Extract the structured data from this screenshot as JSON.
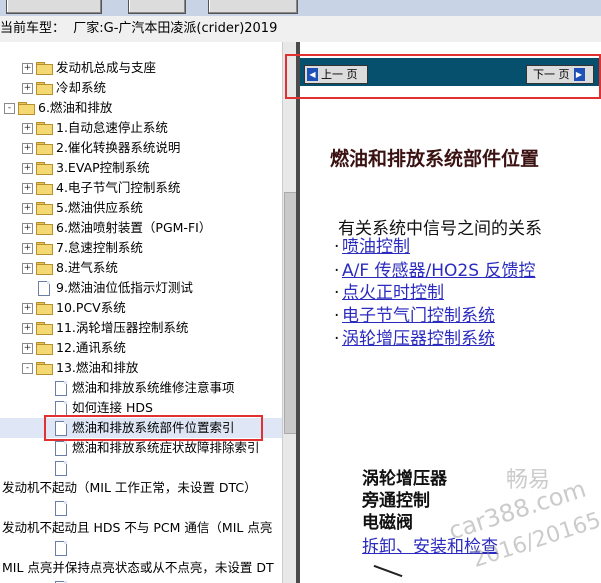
{
  "model": {
    "label": "当前车型：",
    "value": "厂家:G-广汽本田凌派(crider)2019"
  },
  "tree": [
    {
      "text": "发动机总成与支座",
      "type": "folder",
      "expander": "+",
      "indent": 1
    },
    {
      "text": "冷却系统",
      "type": "folder",
      "expander": "+",
      "indent": 1
    },
    {
      "text": "6.燃油和排放",
      "type": "folder",
      "expander": "-",
      "indent": 0
    },
    {
      "text": "1.自动怠速停止系统",
      "type": "folder",
      "expander": "+",
      "indent": 1
    },
    {
      "text": "2.催化转换器系统说明",
      "type": "folder",
      "expander": "+",
      "indent": 1
    },
    {
      "text": "3.EVAP控制系统",
      "type": "folder",
      "expander": "+",
      "indent": 1
    },
    {
      "text": "4.电子节气门控制系统",
      "type": "folder",
      "expander": "+",
      "indent": 1
    },
    {
      "text": "5.燃油供应系统",
      "type": "folder",
      "expander": "+",
      "indent": 1
    },
    {
      "text": "6.燃油喷射装置（PGM-FI）",
      "type": "folder",
      "expander": "+",
      "indent": 1
    },
    {
      "text": "7.怠速控制系统",
      "type": "folder",
      "expander": "+",
      "indent": 1
    },
    {
      "text": "8.进气系统",
      "type": "folder",
      "expander": "+",
      "indent": 1
    },
    {
      "text": "9.燃油油位低指示灯测试",
      "type": "doc",
      "expander": "",
      "indent": 1
    },
    {
      "text": "10.PCV系统",
      "type": "folder",
      "expander": "+",
      "indent": 1
    },
    {
      "text": "11.涡轮增压器控制系统",
      "type": "folder",
      "expander": "+",
      "indent": 1
    },
    {
      "text": "12.通讯系统",
      "type": "folder",
      "expander": "+",
      "indent": 1
    },
    {
      "text": "13.燃油和排放",
      "type": "folder",
      "expander": "-",
      "indent": 1
    },
    {
      "text": "燃油和排放系统维修注意事项",
      "type": "doc",
      "expander": "",
      "indent": 2
    },
    {
      "text": "如何连接 HDS",
      "type": "doc",
      "expander": "",
      "indent": 2
    },
    {
      "text": "燃油和排放系统部件位置索引",
      "type": "doc",
      "expander": "",
      "indent": 2,
      "selected": true
    },
    {
      "text": "燃油和排放系统症状故障排除索引",
      "type": "doc",
      "expander": "",
      "indent": 2
    },
    {
      "text": "",
      "type": "doc",
      "expander": "",
      "indent": 2
    },
    {
      "text": "发动机不起动（MIL 工作正常，未设置 DTC）",
      "type": "text",
      "expander": "",
      "indent": -1
    },
    {
      "text": "",
      "type": "doc",
      "expander": "",
      "indent": 2
    },
    {
      "text": "发动机不起动且 HDS 不与 PCM 通信（MIL 点亮",
      "type": "text",
      "expander": "",
      "indent": -1
    },
    {
      "text": "",
      "type": "doc",
      "expander": "",
      "indent": 2
    },
    {
      "text": "MIL 点亮并保持点亮状态或从不点亮，未设置 DT",
      "type": "text",
      "expander": "",
      "indent": -1
    },
    {
      "text": "",
      "type": "doc",
      "expander": "",
      "indent": 2
    }
  ],
  "nav": {
    "prev_label": "上一 页",
    "next_label": "下一 页"
  },
  "document": {
    "title": "燃油和排放系统部件位置",
    "intro": "有关系统中信号之间的关系",
    "links": [
      "喷油控制",
      "A/F 传感器/HO2S 反馈控",
      "点火正时控制",
      "电子节气门控制系统",
      "涡轮增压器控制系统"
    ],
    "section_lines": [
      "涡轮增压器",
      "旁通控制",
      "电磁阀"
    ],
    "section_link": "拆卸、安装和检查"
  },
  "watermark": {
    "cn": "畅易",
    "site": "car388.com",
    "year": "2016/20165"
  }
}
